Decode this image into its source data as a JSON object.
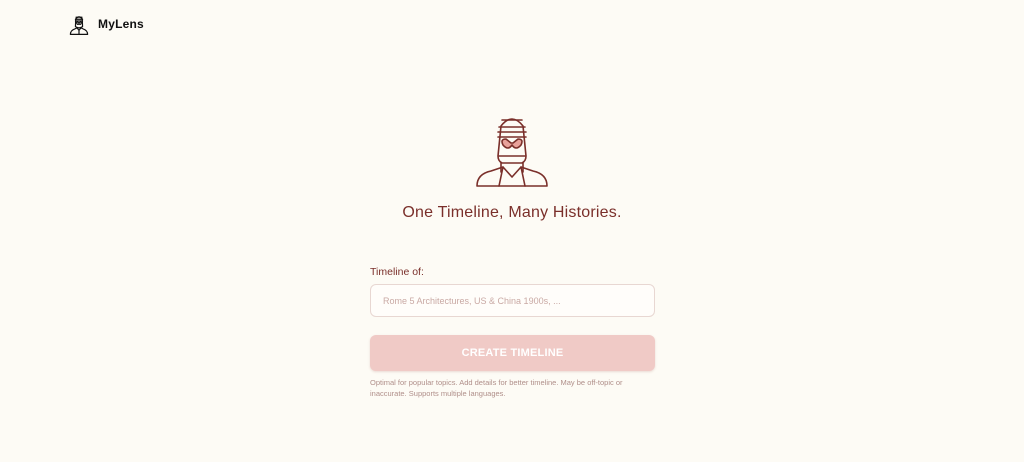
{
  "app": {
    "name": "MyLens",
    "logo_icon": "pharaoh-head-icon"
  },
  "hero": {
    "icon": "pharaoh-head-icon",
    "tagline": "One Timeline, Many Histories."
  },
  "form": {
    "label": "Timeline of:",
    "input_value": "",
    "input_placeholder": "Rome 5 Architectures, US & China 1900s, ...",
    "submit_label": "CREATE TIMELINE",
    "helper_text": "Optimal for popular topics. Add details for better timeline. May be off-topic or inaccurate. Supports multiple languages."
  },
  "colors": {
    "background": "#fdfbf5",
    "accent": "#7a2f2a",
    "accent_light": "#e8a29b",
    "button_disabled": "#f0cac6"
  }
}
